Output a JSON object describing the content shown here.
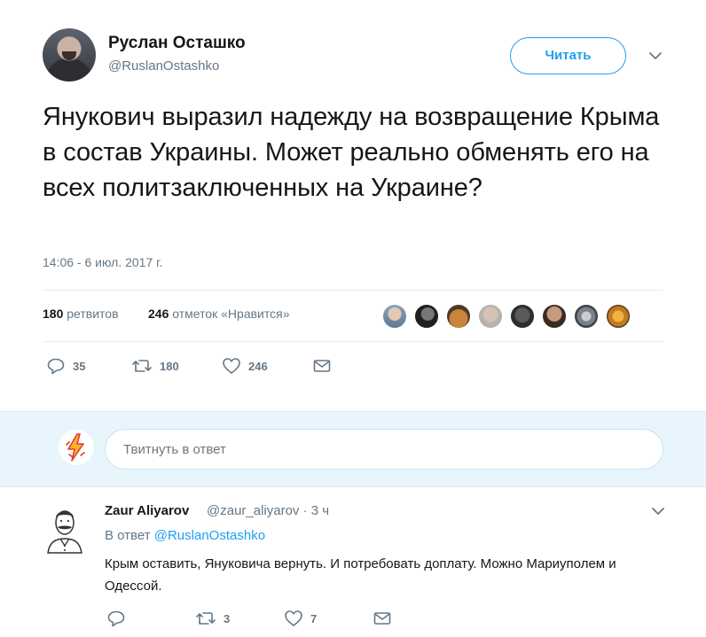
{
  "tweet": {
    "author_name": "Руслан Осташко",
    "author_handle": "@RuslanOstashko",
    "follow_label": "Читать",
    "text": "Янукович выразил надежду на возвращение Крыма в состав Украины. Может реально обменять его на всех политзаключенных на Украине?",
    "timestamp": "14:06 - 6 июл. 2017 г.",
    "retweets_count": "180",
    "retweets_label": "ретвитов",
    "likes_count": "246",
    "likes_label": "отметок «Нравится»",
    "actions": {
      "reply_count": "35",
      "retweet_count": "180",
      "like_count": "246"
    }
  },
  "reply_box": {
    "placeholder": "Твитнуть в ответ"
  },
  "reply": {
    "author_name": "Zaur Aliyarov",
    "author_handle_time": "@zaur_aliyarov · 3 ч",
    "reply_to_prefix": "В ответ",
    "reply_to_mention": "@RuslanOstashko",
    "text": "Крым оставить, Януковича вернуть. И потребовать доплату. Можно Мариуполем и Одессой.",
    "actions": {
      "reply_count": "",
      "retweet_count": "3",
      "like_count": "7"
    }
  },
  "colors": {
    "accent": "#1da1f2",
    "secondary_text": "#657786",
    "reply_box_bg": "#e8f5fd"
  },
  "icons": [
    "chevron-down-icon",
    "reply-icon",
    "retweet-icon",
    "heart-icon",
    "direct-message-icon"
  ]
}
